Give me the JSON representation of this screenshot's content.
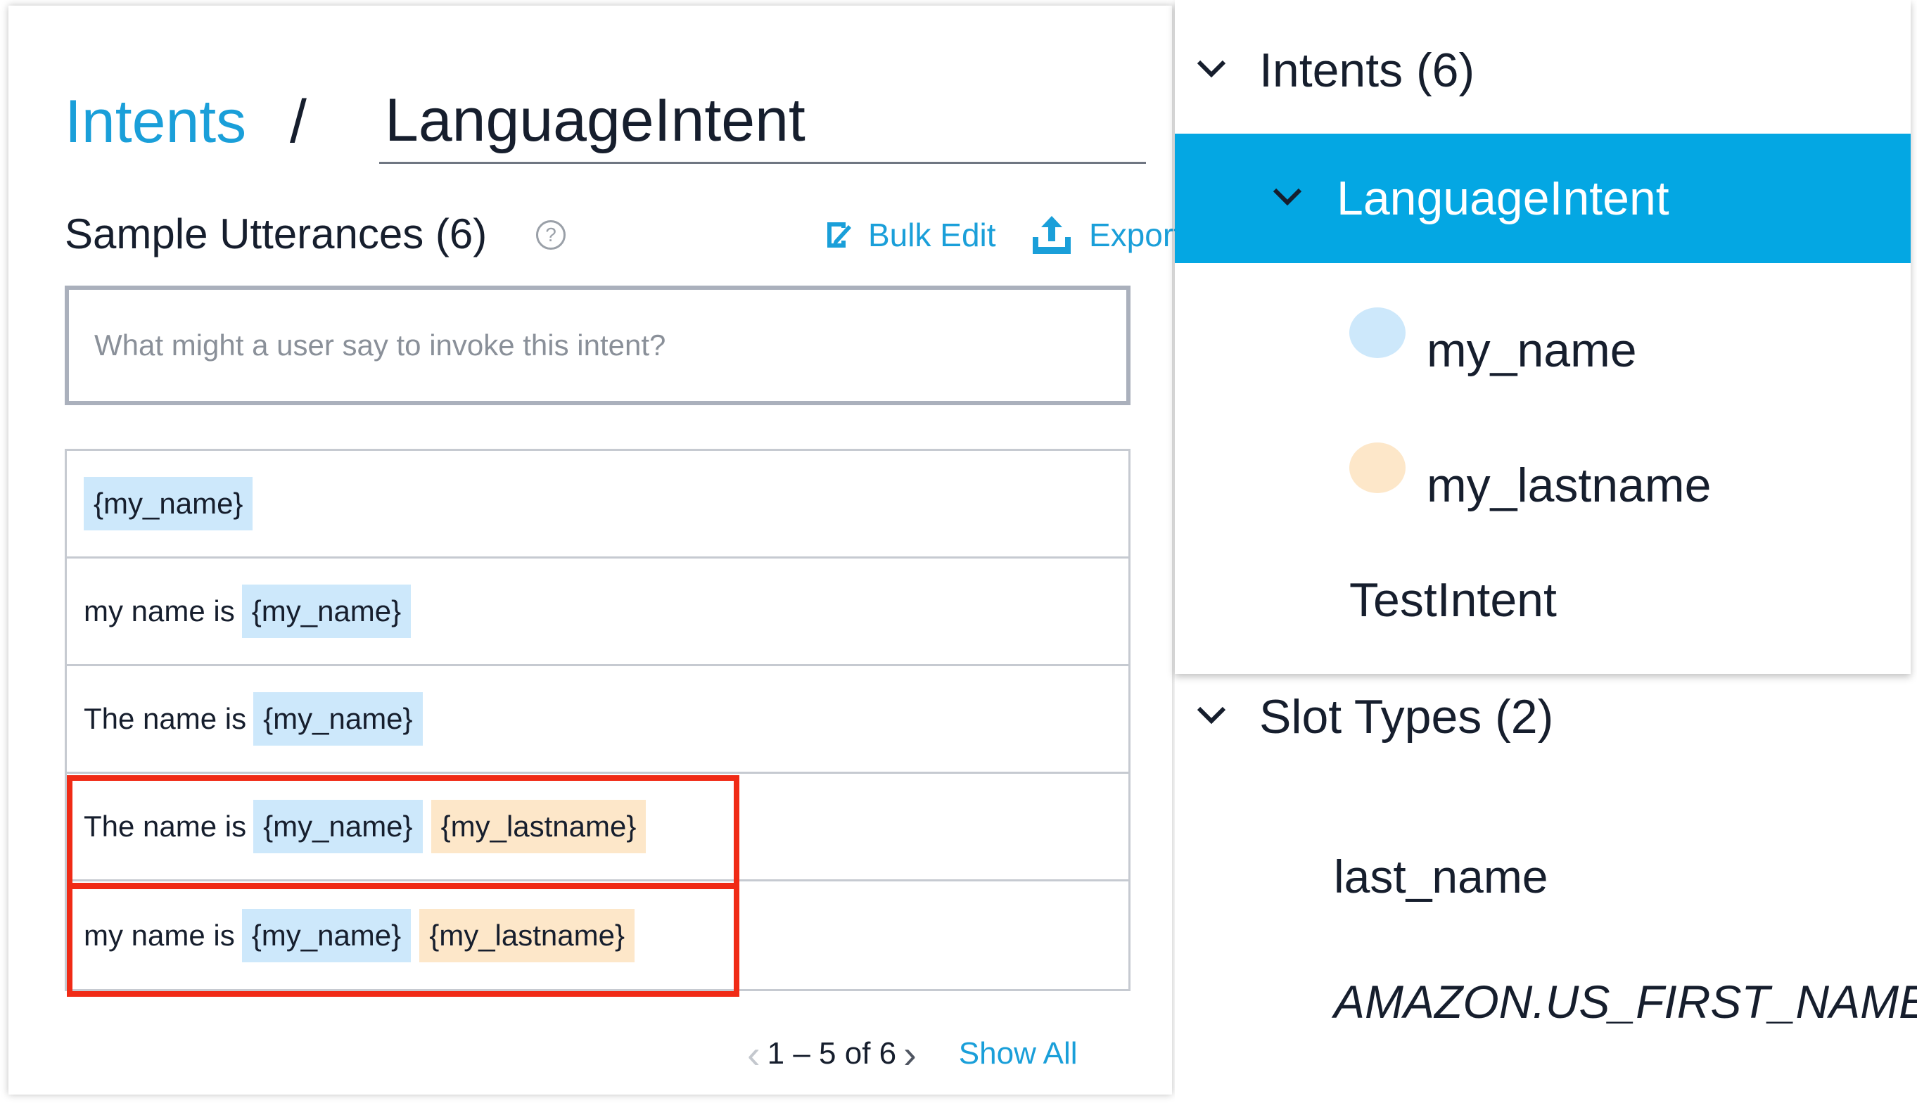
{
  "breadcrumb": {
    "link": "Intents",
    "separator": "/",
    "intent_name": "LanguageIntent"
  },
  "utterances": {
    "title": "Sample Utterances (6)",
    "help": "?",
    "bulk_edit_label": "Bulk Edit",
    "export_label": "Export",
    "input_placeholder": "What might a user say to invoke this intent?",
    "rows": [
      {
        "text": "",
        "slots": [
          "{my_name}"
        ],
        "highlighted": false
      },
      {
        "text": "my name is",
        "slots": [
          "{my_name}"
        ],
        "highlighted": false
      },
      {
        "text": "The name is",
        "slots": [
          "{my_name}"
        ],
        "highlighted": false
      },
      {
        "text": "The name is",
        "slots": [
          "{my_name}",
          "{my_lastname}"
        ],
        "highlighted": true
      },
      {
        "text": "my name is",
        "slots": [
          "{my_name}",
          "{my_lastname}"
        ],
        "highlighted": true
      }
    ],
    "pagination": {
      "info": "1 – 5 of 6",
      "show_all": "Show All"
    }
  },
  "sidebar": {
    "intents_header": "Intents (6)",
    "selected_intent": "LanguageIntent",
    "slots": [
      {
        "name": "my_name",
        "color": "#cde8fb"
      },
      {
        "name": "my_lastname",
        "color": "#fde7c9"
      }
    ],
    "other_intent": "TestIntent",
    "slot_types_header": "Slot Types (2)",
    "slot_types": [
      "last_name",
      "AMAZON.US_FIRST_NAME"
    ]
  },
  "colors": {
    "accent": "#1a9fd9",
    "selected_bg": "#04a7e3",
    "highlight_border": "#f02b16",
    "slot_name_bg": "#cde8fb",
    "slot_lastname_bg": "#fde7c9"
  }
}
